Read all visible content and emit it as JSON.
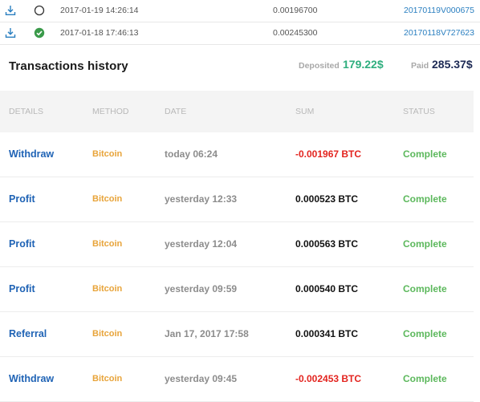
{
  "deposits": [
    {
      "status": "pending",
      "date": "2017-01-19 14:26:14",
      "amount": "0.00196700",
      "txid": "20170119V000675"
    },
    {
      "status": "confirmed",
      "date": "2017-01-18 17:46:13",
      "amount": "0.00245300",
      "txid": "20170118V727623"
    }
  ],
  "history": {
    "title": "Transactions history",
    "deposited_label": "Deposited",
    "deposited_value": "179.22$",
    "paid_label": "Paid",
    "paid_value": "285.37$"
  },
  "columns": {
    "details": "DETAILS",
    "method": "METHOD",
    "date": "DATE",
    "sum": "SUM",
    "status": "STATUS"
  },
  "transactions": [
    {
      "details": "Withdraw",
      "method": "Bitcoin",
      "date": "today 06:24",
      "sum": "-0.001967 BTC",
      "status": "Complete"
    },
    {
      "details": "Profit",
      "method": "Bitcoin",
      "date": "yesterday 12:33",
      "sum": "0.000523 BTC",
      "status": "Complete"
    },
    {
      "details": "Profit",
      "method": "Bitcoin",
      "date": "yesterday 12:04",
      "sum": "0.000563 BTC",
      "status": "Complete"
    },
    {
      "details": "Profit",
      "method": "Bitcoin",
      "date": "yesterday 09:59",
      "sum": "0.000540 BTC",
      "status": "Complete"
    },
    {
      "details": "Referral",
      "method": "Bitcoin",
      "date": "Jan 17, 2017 17:58",
      "sum": "0.000341 BTC",
      "status": "Complete"
    },
    {
      "details": "Withdraw",
      "method": "Bitcoin",
      "date": "yesterday 09:45",
      "sum": "-0.002453 BTC",
      "status": "Complete"
    }
  ],
  "colors": {
    "details_link": "#1f63b5",
    "method": "#e8a43a",
    "negative_sum": "#e3241f",
    "status_complete": "#5cb85c",
    "deposited": "#2fae7e",
    "paid": "#1d2a55",
    "txid_link": "#2a7fc0"
  },
  "icons": {
    "download": "download-icon",
    "pending": "empty-circle-icon",
    "confirmed": "check-circle-icon"
  }
}
